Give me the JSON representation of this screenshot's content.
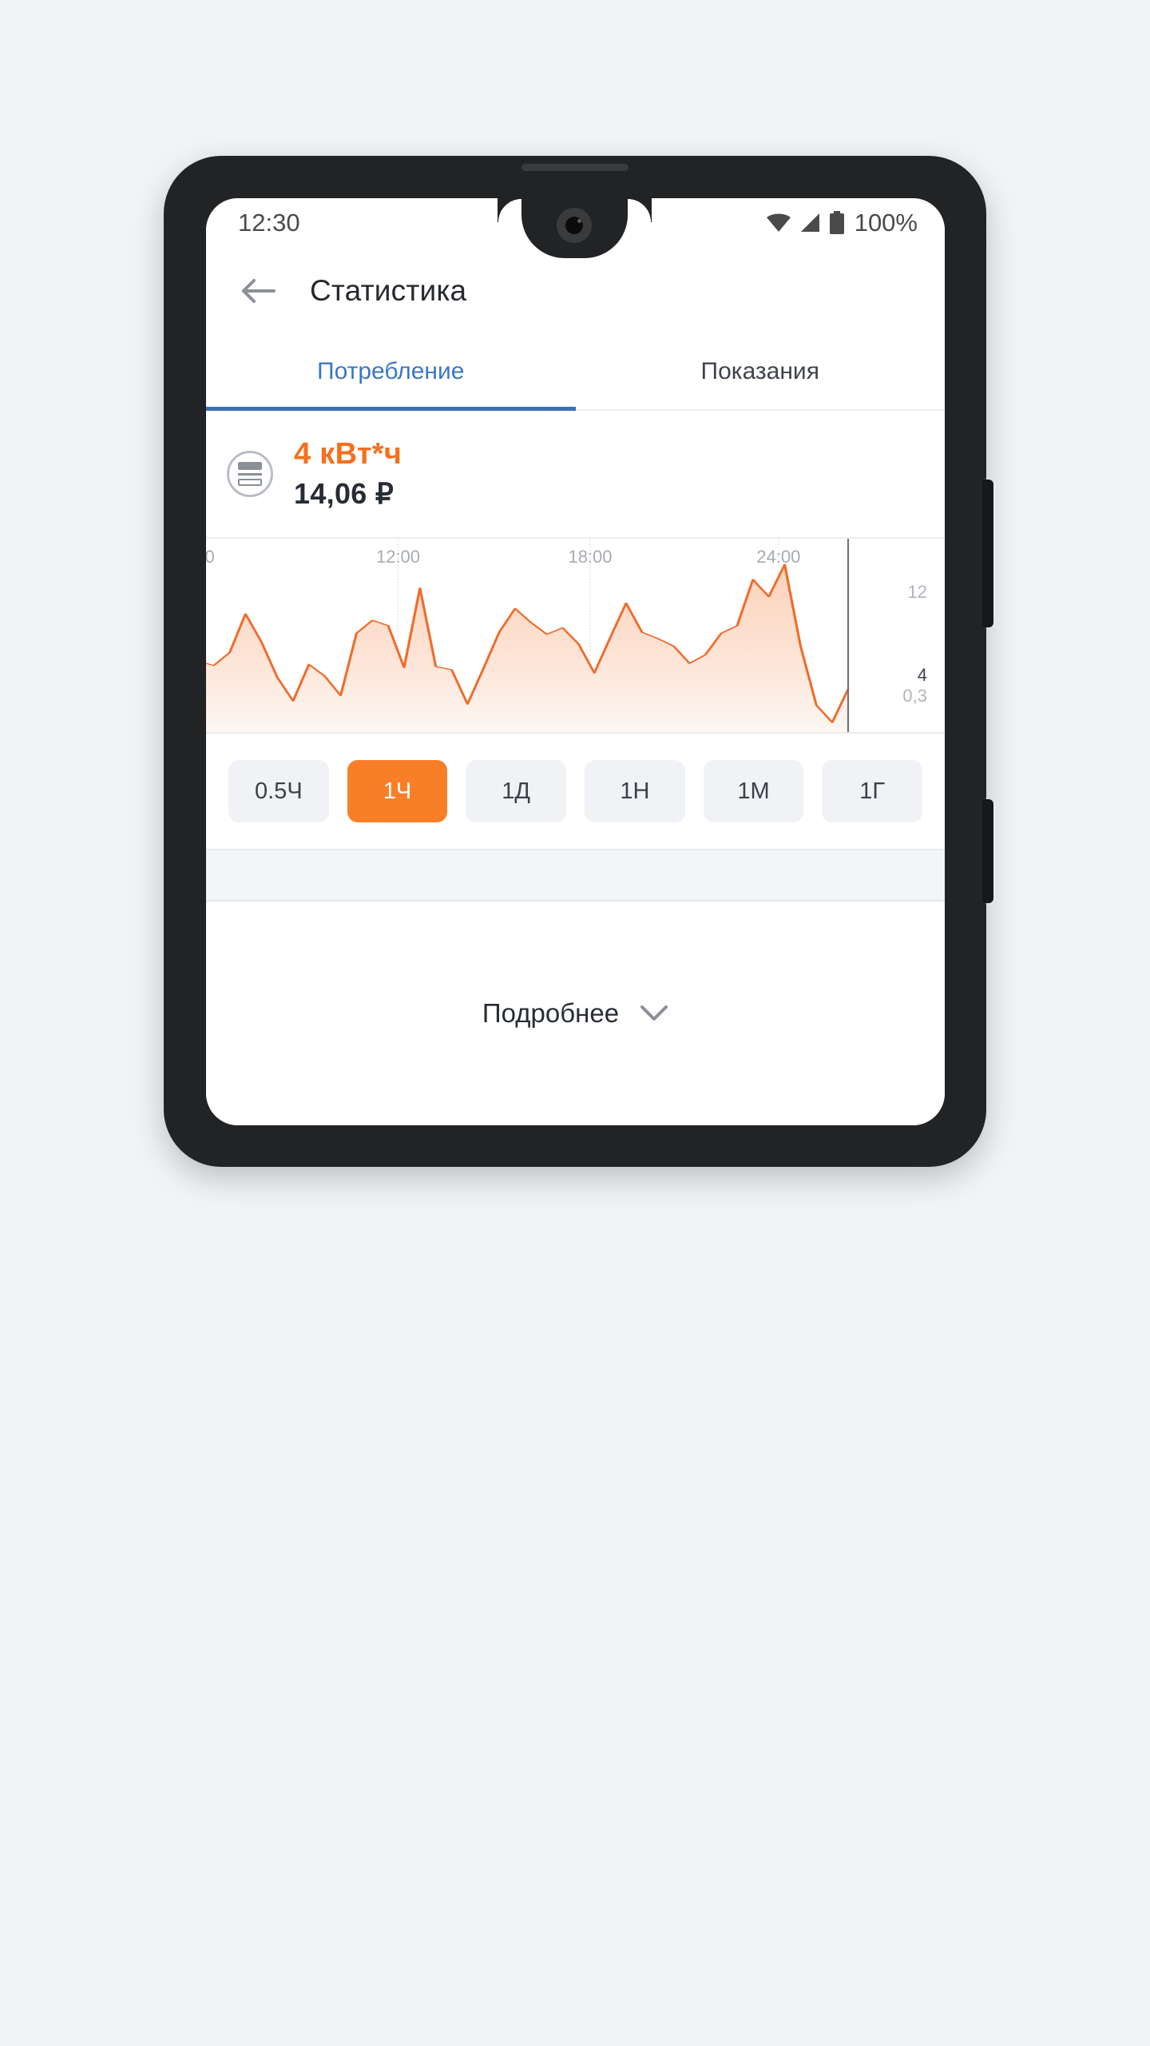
{
  "status_bar": {
    "time": "12:30",
    "battery_percent": "100%",
    "icons": [
      "wifi-icon",
      "signal-icon",
      "battery-icon"
    ]
  },
  "app_bar": {
    "back_icon": "arrow-left-icon",
    "title": "Статистика"
  },
  "tabs": [
    {
      "label": "Потребление",
      "active": true
    },
    {
      "label": "Показания",
      "active": false
    }
  ],
  "summary": {
    "icon": "electricity-meter-icon",
    "energy": "4 кВт*ч",
    "cost": "14,06 ₽",
    "energy_color": "#f4701f",
    "cost_color": "#272c33"
  },
  "range_buttons": [
    {
      "label": "0.5Ч",
      "active": false
    },
    {
      "label": "1Ч",
      "active": true
    },
    {
      "label": "1Д",
      "active": false
    },
    {
      "label": "1Н",
      "active": false
    },
    {
      "label": "1М",
      "active": false
    },
    {
      "label": "1Г",
      "active": false
    }
  ],
  "footer": {
    "label": "Подробнее",
    "icon": "chevron-down-icon"
  },
  "theme": {
    "accent_orange": "#f4701f",
    "button_orange": "#f97e28",
    "tab_blue": "#3b77c4",
    "text_dark": "#272c33",
    "text_muted": "#a6abb2",
    "screen_bg": "#ffffff",
    "page_bg": "#f1f3f7",
    "phone_body": "#222325"
  },
  "chart_data": {
    "type": "area",
    "title": "",
    "xlabel": "",
    "ylabel": "",
    "grid": true,
    "legend": false,
    "xtick_labels": [
      "0",
      "12:00",
      "18:00",
      "24:00"
    ],
    "xtick_positions_pct": [
      0.5,
      26.0,
      52.0,
      77.5
    ],
    "ytick_labels": [
      "12",
      "4",
      "0,3"
    ],
    "ytick_values": [
      12,
      4,
      0.3
    ],
    "ytick_positions_pct": [
      27.5,
      70.5,
      81.5
    ],
    "ylim": [
      0,
      18
    ],
    "series_color": "#ef6c2c",
    "fill_color_top": "#fbd9c6",
    "fill_color_bottom": "#fdf4ef",
    "x": [
      0,
      1,
      2,
      3,
      4,
      5,
      6,
      7,
      8,
      9,
      10,
      11,
      12,
      13,
      14,
      15,
      16,
      17,
      18,
      19,
      20,
      21,
      22,
      23,
      24,
      25,
      26,
      27,
      28,
      29,
      30,
      31,
      32,
      33,
      34,
      35,
      36,
      37,
      38,
      39,
      40,
      41,
      42
    ],
    "values": [
      8.3,
      6.6,
      6.2,
      7.4,
      11.0,
      8.4,
      5.1,
      2.9,
      6.3,
      5.2,
      3.4,
      9.2,
      10.4,
      9.9,
      6.0,
      13.4,
      6.1,
      5.8,
      2.6,
      5.9,
      9.3,
      11.5,
      10.2,
      9.1,
      9.7,
      8.2,
      5.5,
      8.8,
      12.0,
      9.3,
      8.7,
      8.0,
      6.4,
      7.2,
      9.2,
      9.9,
      14.2,
      12.6,
      15.6,
      8.0,
      2.5,
      0.9,
      4.0
    ]
  }
}
